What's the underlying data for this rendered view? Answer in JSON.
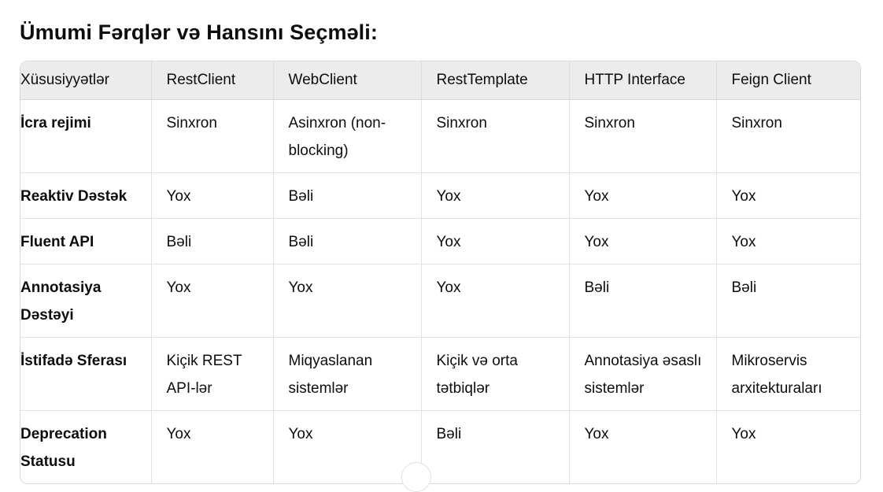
{
  "title": "Ümumi Fərqlər və Hansını Seçməli:",
  "table": {
    "headers": [
      "Xüsusiyyətlər",
      "RestClient",
      "WebClient",
      "RestTemplate",
      "HTTP Interface",
      "Feign Client"
    ],
    "rows": [
      [
        "İcra rejimi",
        "Sinxron",
        "Asinxron (non-blocking)",
        "Sinxron",
        "Sinxron",
        "Sinxron"
      ],
      [
        "Reaktiv Dəstək",
        "Yox",
        "Bəli",
        "Yox",
        "Yox",
        "Yox"
      ],
      [
        "Fluent API",
        "Bəli",
        "Bəli",
        "Yox",
        "Yox",
        "Yox"
      ],
      [
        "Annotasiya Dəstəyi",
        "Yox",
        "Yox",
        "Yox",
        "Bəli",
        "Bəli"
      ],
      [
        "İstifadə Sferası",
        "Kiçik REST API-lər",
        "Miqyaslanan sistemlər",
        "Kiçik və orta tətbiqlər",
        "Annotasiya əsaslı sistemlər",
        "Mikroservis arxitekturaları"
      ],
      [
        "Deprecation Statusu",
        "Yox",
        "Yox",
        "Bəli",
        "Yox",
        "Yox"
      ]
    ]
  }
}
